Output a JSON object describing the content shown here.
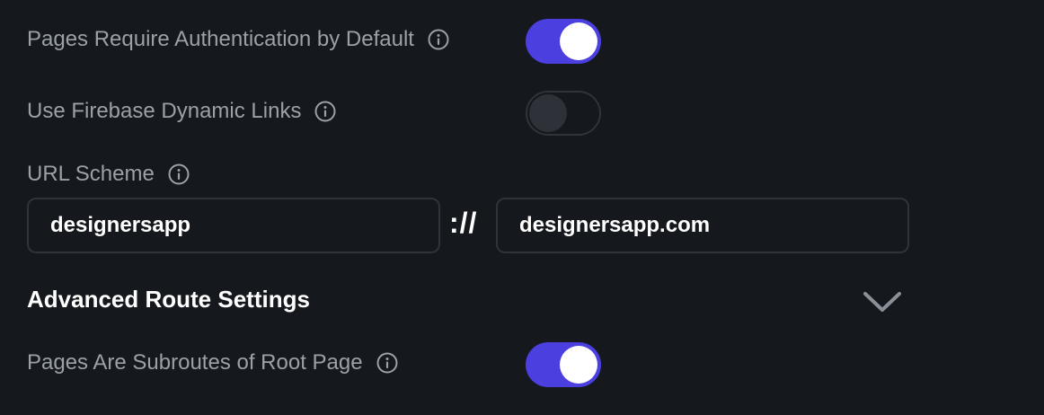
{
  "settings": {
    "auth_default": {
      "label": "Pages Require Authentication by Default",
      "enabled": true
    },
    "firebase_links": {
      "label": "Use Firebase Dynamic Links",
      "enabled": false
    },
    "url_scheme": {
      "label": "URL Scheme",
      "scheme_value": "designersapp",
      "separator": "://",
      "host_value": "designersapp.com"
    },
    "advanced": {
      "title": "Advanced Route Settings",
      "icon": "chevron-down-icon"
    },
    "subroutes": {
      "label": "Pages Are Subroutes of Root Page",
      "enabled": true
    }
  },
  "colors": {
    "accent": "#4b3fe0",
    "background": "#15181c",
    "label": "#9ba1a9",
    "border": "#2f343a"
  }
}
